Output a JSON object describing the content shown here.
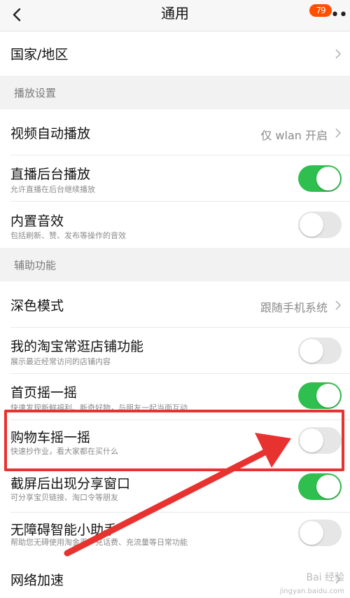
{
  "nav": {
    "title": "通用",
    "badge": "79"
  },
  "rows": {
    "country": {
      "label": "国家/地区"
    },
    "autoplay": {
      "label": "视频自动播放",
      "value": "仅 wlan 开启"
    },
    "live_bg": {
      "label": "直播后台播放",
      "sub": "允许直播在后台继续播放",
      "on": true
    },
    "sound": {
      "label": "内置音效",
      "sub": "包括刷新、赞、发布等操作的音效",
      "on": false
    },
    "dark": {
      "label": "深色模式",
      "value": "跟随手机系统"
    },
    "my_shops": {
      "label": "我的淘宝常逛店铺功能",
      "sub": "展示最近经常访问的店铺内容",
      "on": false
    },
    "home_shake": {
      "label": "首页摇一摇",
      "sub": "快速发现新鲜福利、新奇好物，与朋友一起当面互动",
      "on": true
    },
    "cart_shake": {
      "label": "购物车摇一摇",
      "sub": "快速抄作业，看大家都在买什么",
      "on": false
    },
    "screenshot_share": {
      "label": "截屏后出现分享窗口",
      "sub": "可分享宝贝链接、淘口令等朋友",
      "on": true
    },
    "accessibility": {
      "label": "无障碍智能小助手",
      "sub": "帮助您无碍使用淘金币、充话费、充流量等日常功能",
      "on": false
    },
    "network": {
      "label": "网络加速"
    }
  },
  "sections": {
    "playback": "播放设置",
    "assist": "辅助功能"
  },
  "watermark": {
    "line1": "Bai 经验",
    "line2": "jingyan.baidu.com"
  },
  "colors": {
    "toggle_on": "#2fbf4e",
    "toggle_off": "#e6e6e6",
    "annotation": "#e8322f",
    "badge": "#ff5000"
  },
  "icons": {
    "back": "chevron-left-icon",
    "more": "more-dots-icon",
    "chevron": "chevron-right-icon"
  }
}
